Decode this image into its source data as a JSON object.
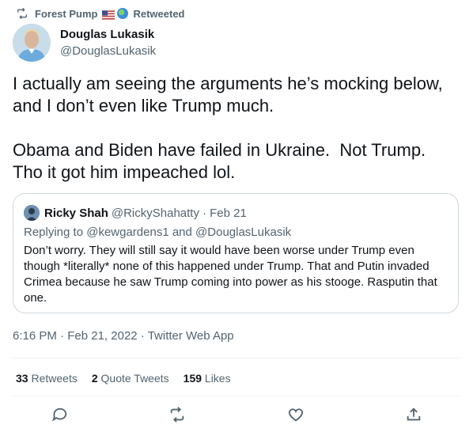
{
  "retweet_context": {
    "retweeter": "Forest Pump",
    "label": "Retweeted"
  },
  "author": {
    "name": "Douglas Lukasik",
    "handle": "@DouglasLukasik"
  },
  "tweet": {
    "text": "I actually am seeing the arguments he’s mocking below, and I don’t even like Trump much.\n\nObama and Biden have failed in Ukraine.  Not Trump. Tho it got him impeached lol."
  },
  "quoted_tweet": {
    "name": "Ricky Shah",
    "handle": "@RickyShahatty",
    "date": "· Feb 21",
    "replying_prefix": "Replying to",
    "mention_1": "@kewgardens1",
    "and": "and",
    "mention_2": "@DouglasLukasik",
    "text": "Don’t worry. They will still say it would have been worse under Trump even though *literally* none of this happened under Trump. That and Putin invaded Crimea because he saw Trump coming into power as his stooge. Rasputin that one."
  },
  "meta": {
    "time": "6:16 PM",
    "sep1": "·",
    "date": "Feb 21, 2022",
    "sep2": "·",
    "source": "Twitter Web App"
  },
  "stats": {
    "retweets_count": "33",
    "retweets_label": "Retweets",
    "quotes_count": "2",
    "quotes_label": "Quote Tweets",
    "likes_count": "159",
    "likes_label": "Likes"
  },
  "actions": [
    "reply-icon",
    "retweet-icon",
    "like-icon",
    "share-icon"
  ],
  "colors": {
    "text": "#0f1419",
    "secondary": "#536471",
    "border": "#cfd9de"
  }
}
